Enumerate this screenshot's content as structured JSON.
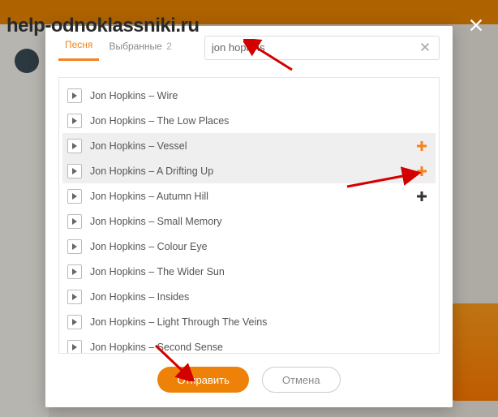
{
  "watermark": "help-odnoklassniki.ru",
  "tabs": [
    {
      "label": "Песня",
      "active": true
    },
    {
      "label": "Выбранные",
      "count": "2",
      "active": false
    }
  ],
  "search": {
    "value": "jon hopkins"
  },
  "tracks": [
    {
      "title": "Jon Hopkins – Wire",
      "hover": false,
      "add": null
    },
    {
      "title": "Jon Hopkins – The Low Places",
      "hover": false,
      "add": null
    },
    {
      "title": "Jon Hopkins – Vessel",
      "hover": true,
      "add": "orange"
    },
    {
      "title": "Jon Hopkins – A Drifting Up",
      "hover": true,
      "add": "orange"
    },
    {
      "title": "Jon Hopkins – Autumn Hill",
      "hover": false,
      "add": "black"
    },
    {
      "title": "Jon Hopkins – Small Memory",
      "hover": false,
      "add": null
    },
    {
      "title": "Jon Hopkins – Colour Eye",
      "hover": false,
      "add": null
    },
    {
      "title": "Jon Hopkins – The Wider Sun",
      "hover": false,
      "add": null
    },
    {
      "title": "Jon Hopkins – Insides",
      "hover": false,
      "add": null
    },
    {
      "title": "Jon Hopkins – Light Through The Veins",
      "hover": false,
      "add": null
    },
    {
      "title": "Jon Hopkins – Second Sense",
      "hover": false,
      "add": null
    }
  ],
  "buttons": {
    "submit": "Отправить",
    "cancel": "Отмена"
  },
  "annotations": {
    "a1": "1",
    "a2": "2",
    "a3": "3"
  }
}
